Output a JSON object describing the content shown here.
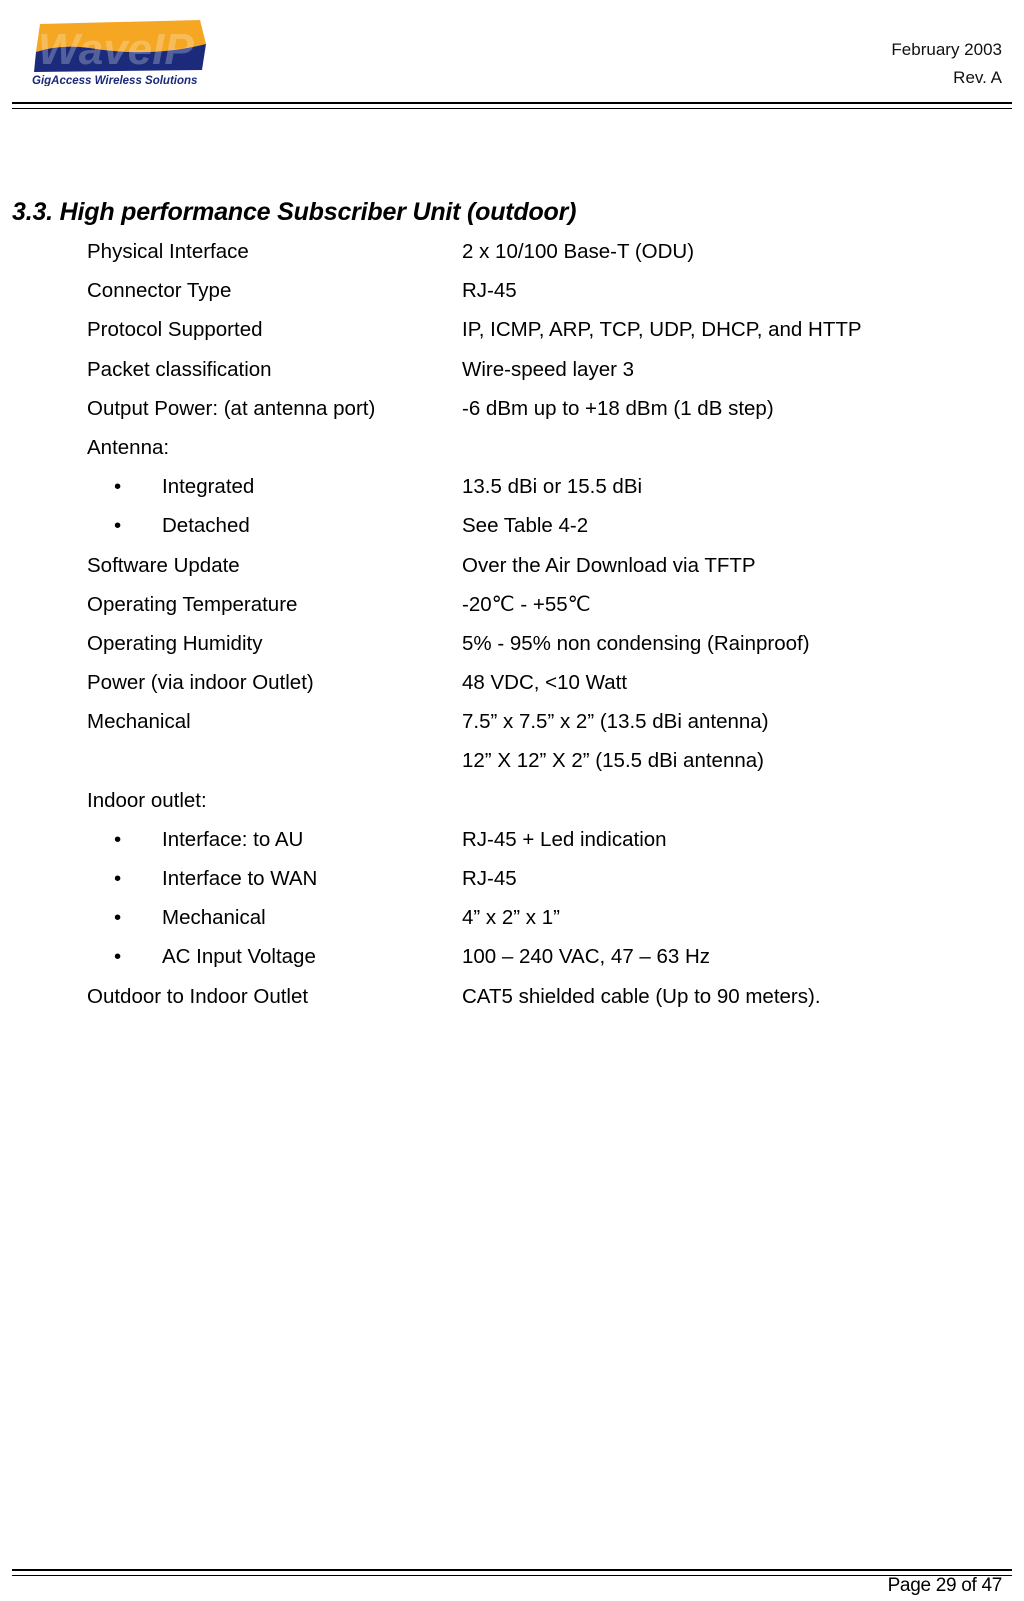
{
  "header": {
    "logo": {
      "brand": "WaveIP",
      "tagline": "GigAccess Wireless Solutions",
      "colors": {
        "orange": "#F5A623",
        "navy": "#1B2A7A"
      }
    },
    "date": "February 2003",
    "revision": "Rev. A"
  },
  "section": {
    "title": "3.3. High performance Subscriber Unit (outdoor)"
  },
  "specs": [
    {
      "label": "Physical Interface",
      "value": "2 x 10/100 Base-T (ODU)",
      "bullet": false
    },
    {
      "label": "Connector Type",
      "value": "RJ-45",
      "bullet": false
    },
    {
      "label": "Protocol Supported",
      "value": "IP, ICMP, ARP, TCP, UDP, DHCP, and HTTP",
      "bullet": false
    },
    {
      "label": "Packet classification",
      "value": "Wire-speed layer 3",
      "bullet": false
    },
    {
      "label": "Output Power: (at antenna port)",
      "value": "-6 dBm up to  +18 dBm (1 dB step)",
      "bullet": false
    },
    {
      "label": "Antenna:",
      "value": "",
      "bullet": false
    },
    {
      "label": "Integrated",
      "value": "13.5 dBi or 15.5 dBi",
      "bullet": true
    },
    {
      "label": "Detached",
      "value": "See Table 4-2",
      "bullet": true
    },
    {
      "label": "Software Update",
      "value": "Over the Air Download via TFTP",
      "bullet": false
    },
    {
      "label": "Operating Temperature",
      "value": "-20℃ - +55℃",
      "bullet": false
    },
    {
      "label": "Operating Humidity",
      "value": "5% - 95% non condensing (Rainproof)",
      "bullet": false
    },
    {
      "label": "Power (via indoor Outlet)",
      "value": "48 VDC, <10 Watt",
      "bullet": false
    },
    {
      "label": "Mechanical",
      "value": "7.5” x 7.5” x 2” (13.5 dBi antenna)",
      "bullet": false
    },
    {
      "label": "",
      "value": "12” X 12” X 2”  (15.5 dBi antenna)",
      "bullet": false
    },
    {
      "label": "Indoor outlet:",
      "value": "",
      "bullet": false
    },
    {
      "label": "Interface: to AU",
      "value": "RJ-45 + Led indication",
      "bullet": true
    },
    {
      "label": "Interface to WAN",
      "value": "RJ-45",
      "bullet": true
    },
    {
      "label": "Mechanical",
      "value": "4” x 2” x 1”",
      "bullet": true
    },
    {
      "label": "AC Input Voltage",
      "value": "100 – 240 VAC, 47 – 63 Hz",
      "bullet": true
    },
    {
      "label": "Outdoor to Indoor Outlet",
      "value": "CAT5 shielded cable (Up to 90 meters).",
      "bullet": false
    }
  ],
  "bullet_glyph": "•",
  "footer": {
    "page": "Page 29 of 47"
  }
}
